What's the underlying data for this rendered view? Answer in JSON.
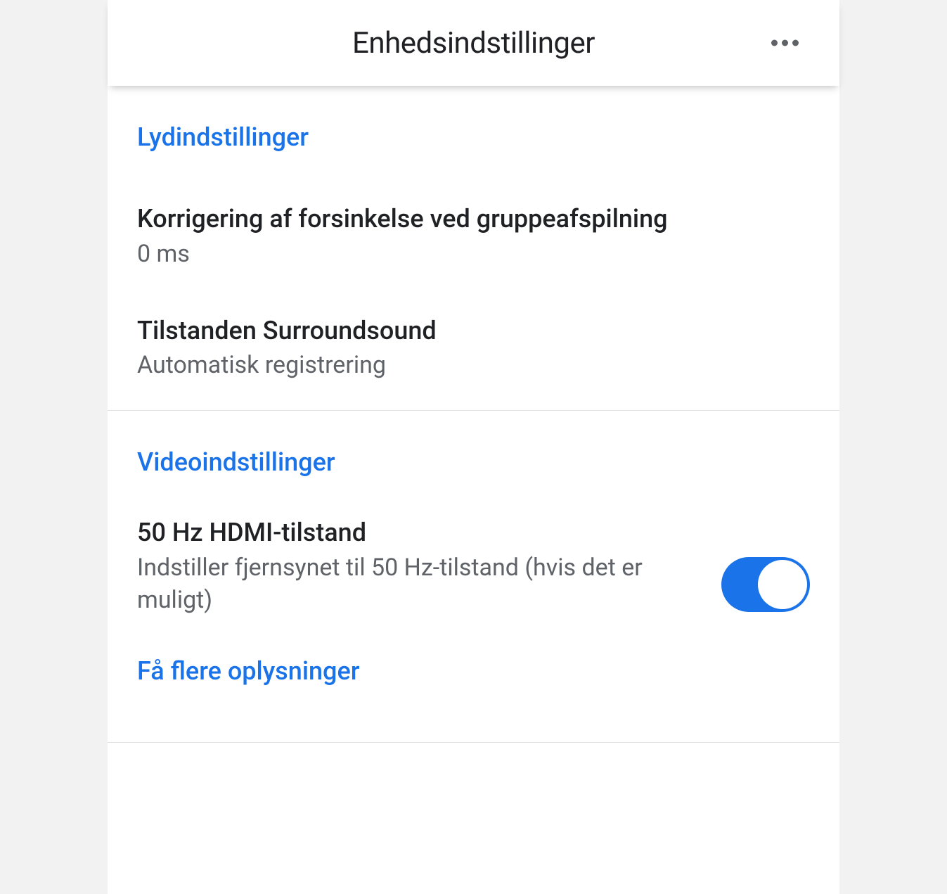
{
  "header": {
    "title": "Enhedsindstillinger"
  },
  "sections": {
    "audio": {
      "header": "Lydindstillinger",
      "delay": {
        "title": "Korrigering af forsinkelse ved gruppeafspilning",
        "value": "0 ms"
      },
      "surround": {
        "title": "Tilstanden Surroundsound",
        "value": "Automatisk registrering"
      }
    },
    "video": {
      "header": "Videoindstillinger",
      "hdmi": {
        "title": "50 Hz HDMI-tilstand",
        "description": "Indstiller fjernsynet til 50 Hz-tilstand (hvis det er muligt)",
        "toggle_on": true
      },
      "more_info": "Få flere oplysninger"
    }
  }
}
